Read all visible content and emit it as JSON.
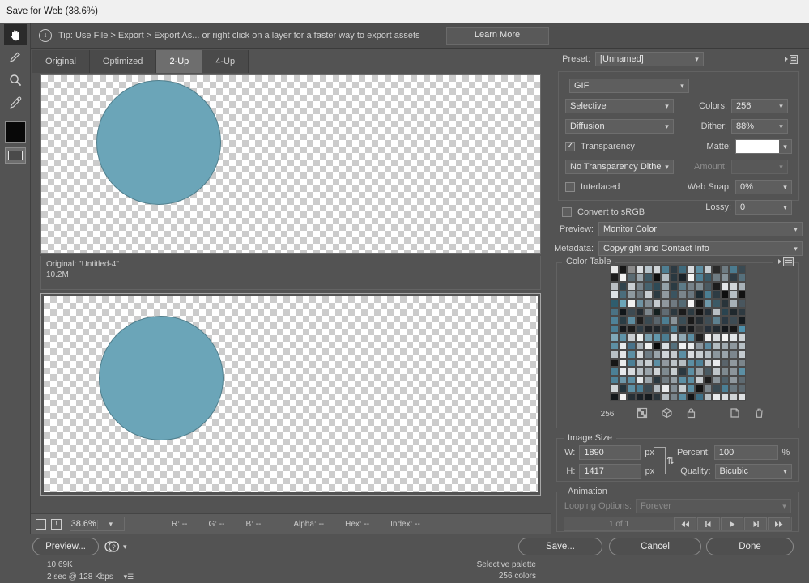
{
  "window": {
    "title": "Save for Web (38.6%)"
  },
  "tip": {
    "text": "Tip: Use File > Export > Export As...  or right click on a layer for a faster way to export assets",
    "learn_more_label": "Learn More",
    "info_icon": "info-icon"
  },
  "toolbar": {
    "tools": [
      {
        "name": "hand-tool",
        "selected": true
      },
      {
        "name": "slice-select-tool",
        "selected": false
      },
      {
        "name": "zoom-tool",
        "selected": false
      },
      {
        "name": "eyedropper-tool",
        "selected": false
      }
    ],
    "foreground_color": "#080808",
    "slice_visibility_name": "toggle-slices-visibility"
  },
  "preview": {
    "tabs": [
      {
        "label": "Original",
        "selected": false
      },
      {
        "label": "Optimized",
        "selected": false
      },
      {
        "label": "2-Up",
        "selected": true
      },
      {
        "label": "4-Up",
        "selected": false
      }
    ],
    "original_pane": {
      "line1": "Original: \"Untitled-4\"",
      "line2": "10.2M"
    },
    "optimized_pane": {
      "format": "GIF",
      "filesize": "10.69K",
      "download_time": "2 sec @ 128 Kbps",
      "dither": "88% dither",
      "palette": "Selective palette",
      "colors": "256 colors"
    },
    "artwork_color": "#6ba5b8"
  },
  "statusbar": {
    "zoom_value": "38.6%",
    "readouts": [
      "R: --",
      "G: --",
      "B: --"
    ],
    "readouts2": [
      "Alpha: --",
      "Hex: --",
      "Index: --"
    ]
  },
  "bottom_buttons": {
    "preview": "Preview...",
    "save": "Save...",
    "cancel": "Cancel",
    "done": "Done"
  },
  "settings": {
    "preset_label": "Preset:",
    "preset_value": "[Unnamed]",
    "format_value": "GIF",
    "reduction_algorithm": "Selective",
    "dither_algorithm": "Diffusion",
    "transparency_label": "Transparency",
    "transparency_checked": true,
    "transparency_dither": "No Transparency Dither",
    "interlaced_label": "Interlaced",
    "interlaced_checked": false,
    "colors_label": "Colors:",
    "colors_value": "256",
    "dither_label": "Dither:",
    "dither_value": "88%",
    "matte_label": "Matte:",
    "matte_color": "#ffffff",
    "amount_label": "Amount:",
    "amount_value": "",
    "websnap_label": "Web Snap:",
    "websnap_value": "0%",
    "lossy_label": "Lossy:",
    "lossy_value": "0",
    "convert_srgb_label": "Convert to sRGB",
    "convert_srgb_checked": false,
    "preview_label": "Preview:",
    "preview_value": "Monitor Color",
    "metadata_label": "Metadata:",
    "metadata_value": "Copyright and Contact Info"
  },
  "color_table": {
    "title": "Color Table",
    "count": "256",
    "icons": [
      "web-snap-icon",
      "cube-icon",
      "lock-icon",
      "new-color-icon",
      "delete-color-icon"
    ],
    "swatches": [
      "#e8e8e8",
      "#161616",
      "#8a8a8a",
      "#d9dde0",
      "#b7c4cb",
      "#cfd4d7",
      "#4f7f93",
      "#2d3a42",
      "#3f6a7c",
      "#d6dade",
      "#5d8ea2",
      "#c3cbd0",
      "#2a2a2a",
      "#6e7b82",
      "#4b7b8f",
      "#3a4a52",
      "#1c1c1c",
      "#f2f2f2",
      "#5a6a72",
      "#9aa6ad",
      "#3e5a66",
      "#0f0f0f",
      "#b3bdc3",
      "#2a3840",
      "#1a2228",
      "#f5f5f5",
      "#4e8096",
      "#3a5a68",
      "#6f7c83",
      "#87939a",
      "#2f3c44",
      "#56707c",
      "#b9bec2",
      "#31444d",
      "#c9ced2",
      "#7a858c",
      "#46626e",
      "#2e4a56",
      "#93a0a7",
      "#2b3b43",
      "#5d7b88",
      "#778289",
      "#7e8c93",
      "#4a5a62",
      "#1c1c1c",
      "#e4e7ea",
      "#d0d6da",
      "#a8b2b8",
      "#dfe2e5",
      "#4b6d7c",
      "#8e999f",
      "#707a80",
      "#c8cdd1",
      "#2b3a42",
      "#90999f",
      "#3b5460",
      "#7a858c",
      "#6a7780",
      "#1b2a32",
      "#4b7e92",
      "#2e3c44",
      "#0e0e0e",
      "#b6bfc5",
      "#111111",
      "#2f5d6e",
      "#6ba5b8",
      "#f0f0f0",
      "#6f92a2",
      "#838e95",
      "#c6cbcf",
      "#8f989e",
      "#707a81",
      "#546a74",
      "#f4f4f4",
      "#1b1b1b",
      "#6e99aa",
      "#3b5a66",
      "#29343a",
      "#a7b1b7",
      "#49565e",
      "#4a7284",
      "#10161a",
      "#3d4a52",
      "#242c32",
      "#7d878d",
      "#14201f",
      "#616c73",
      "#2c383f",
      "#1b1b1b",
      "#2c3a41",
      "#141414",
      "#263038",
      "#b9c0c5",
      "#2a4450",
      "#1f282d",
      "#2e3a41",
      "#4f8298",
      "#2a3c44",
      "#5d8ca0",
      "#1f1f1f",
      "#3a4a52",
      "#5a666d",
      "#4c7e92",
      "#8a949a",
      "#3a4d56",
      "#1a1a1a",
      "#262d32",
      "#3f4d55",
      "#5d808f",
      "#2b3943",
      "#3d4b53",
      "#161c20",
      "#4b7f95",
      "#15181b",
      "#1b1b1b",
      "#2e3c45",
      "#1e2226",
      "#20262a",
      "#2f3a40",
      "#4e7f94",
      "#1c2227",
      "#181a1c",
      "#3b3b3b",
      "#26303a",
      "#222a30",
      "#12161a",
      "#151515",
      "#4f90ab",
      "#7fa8b8",
      "#5f93a8",
      "#c9ced2",
      "#ecefef",
      "#7ba1b0",
      "#6298ad",
      "#4c7d91",
      "#d9dde0",
      "#8fa8b4",
      "#5b8ea3",
      "#1f1f1f",
      "#f0f0f0",
      "#d7dbde",
      "#f4f4f4",
      "#e2e6e8",
      "#cdd2d5",
      "#5d8fa3",
      "#e8eaec",
      "#48728a",
      "#a9b2b8",
      "#f0f0f0",
      "#0a0a0a",
      "#d9dde0",
      "#55707d",
      "#eef0f1",
      "#e9ebec",
      "#8d979d",
      "#5d8ba0",
      "#b2bbc0",
      "#a0aab0",
      "#8e989e",
      "#b7c0c5",
      "#b8c0c5",
      "#e4e6e8",
      "#5c8fa4",
      "#d6dadd",
      "#6f7d85",
      "#9aa4aa",
      "#cfd4d7",
      "#c5cbcf",
      "#5c8fa4",
      "#d8dcdf",
      "#c8ced1",
      "#b5bec3",
      "#8c979d",
      "#9aa4aa",
      "#7c868d",
      "#c3cacf",
      "#161616",
      "#eaecec",
      "#4c7f95",
      "#b6bec3",
      "#c8ced1",
      "#5c8fa4",
      "#92999f",
      "#bdc4c8",
      "#b6bec3",
      "#5c8fa4",
      "#4f8298",
      "#c5cbcf",
      "#e8eaec",
      "#5a646b",
      "#90999f",
      "#7b858b",
      "#4b7f95",
      "#e8eaec",
      "#d6dadd",
      "#b8c0c5",
      "#9aa4aa",
      "#cfd4d7",
      "#7f8a90",
      "#c8ced1",
      "#2b3840",
      "#5c8fa4",
      "#9aa4aa",
      "#4a5a62",
      "#bfc6ca",
      "#7f8a90",
      "#8c959b",
      "#5c8fa4",
      "#4e8298",
      "#6d96a8",
      "#5c8fa4",
      "#e4e7e9",
      "#9ba5ab",
      "#2a3840",
      "#727d84",
      "#96a0a6",
      "#5c8fa4",
      "#5c8fa4",
      "#c9ced2",
      "#1c1c1c",
      "#8b959b",
      "#51626b",
      "#8f989e",
      "#5e6a71",
      "#d0d5d8",
      "#22323a",
      "#5c8fa4",
      "#4b7f95",
      "#3b4a52",
      "#b4bcc1",
      "#e8eaec",
      "#838e95",
      "#c8ced1",
      "#5c8fa4",
      "#131313",
      "#7e888e",
      "#3a4a52",
      "#4b7f95",
      "#6a7880",
      "#5e6a71",
      "#12171a",
      "#f2f2f2",
      "#262f35",
      "#1b2228",
      "#151a1e",
      "#2a343a",
      "#b6bec3",
      "#79848b",
      "#5c8fa4",
      "#121518",
      "#3d6f86",
      "#b6bec3",
      "#e9ebec",
      "#d8dcdf",
      "#cfd4d7",
      "#dde0e2"
    ]
  },
  "image_size": {
    "title": "Image Size",
    "w_label": "W:",
    "w_value": "1890",
    "w_unit": "px",
    "h_label": "H:",
    "h_value": "1417",
    "h_unit": "px",
    "percent_label": "Percent:",
    "percent_value": "100",
    "percent_unit": "%",
    "quality_label": "Quality:",
    "quality_value": "Bicubic",
    "link_icon": "link-constrain-icon"
  },
  "animation": {
    "title": "Animation",
    "looping_label": "Looping Options:",
    "looping_value": "Forever",
    "frame_count": "1 of 1",
    "buttons": [
      "first-frame-button",
      "previous-frame-button",
      "play-button",
      "next-frame-button",
      "last-frame-button"
    ]
  }
}
